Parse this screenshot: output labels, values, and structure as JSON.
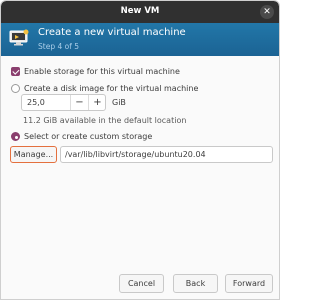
{
  "window": {
    "title": "New VM"
  },
  "header": {
    "title": "Create a new virtual machine",
    "step": "Step 4 of 5",
    "icon": "vm-monitor-icon"
  },
  "storage": {
    "enable_label": "Enable storage for this virtual machine",
    "enable_checked": true,
    "create_disk_label": "Create a disk image for the virtual machine",
    "disk_size_value": "25,0",
    "disk_size_unit": "GiB",
    "available_text": "11.2 GiB available in the default location",
    "custom_label": "Select or create custom storage",
    "selected_option": "custom",
    "manage_label": "Manage...",
    "path_value": "/var/lib/libvirt/storage/ubuntu20.04"
  },
  "buttons": {
    "cancel": "Cancel",
    "back": "Back",
    "forward": "Forward"
  },
  "colors": {
    "accent": "#8a3f6e",
    "header_bg": "#1f6f9f",
    "focus_border": "#e4703e"
  }
}
